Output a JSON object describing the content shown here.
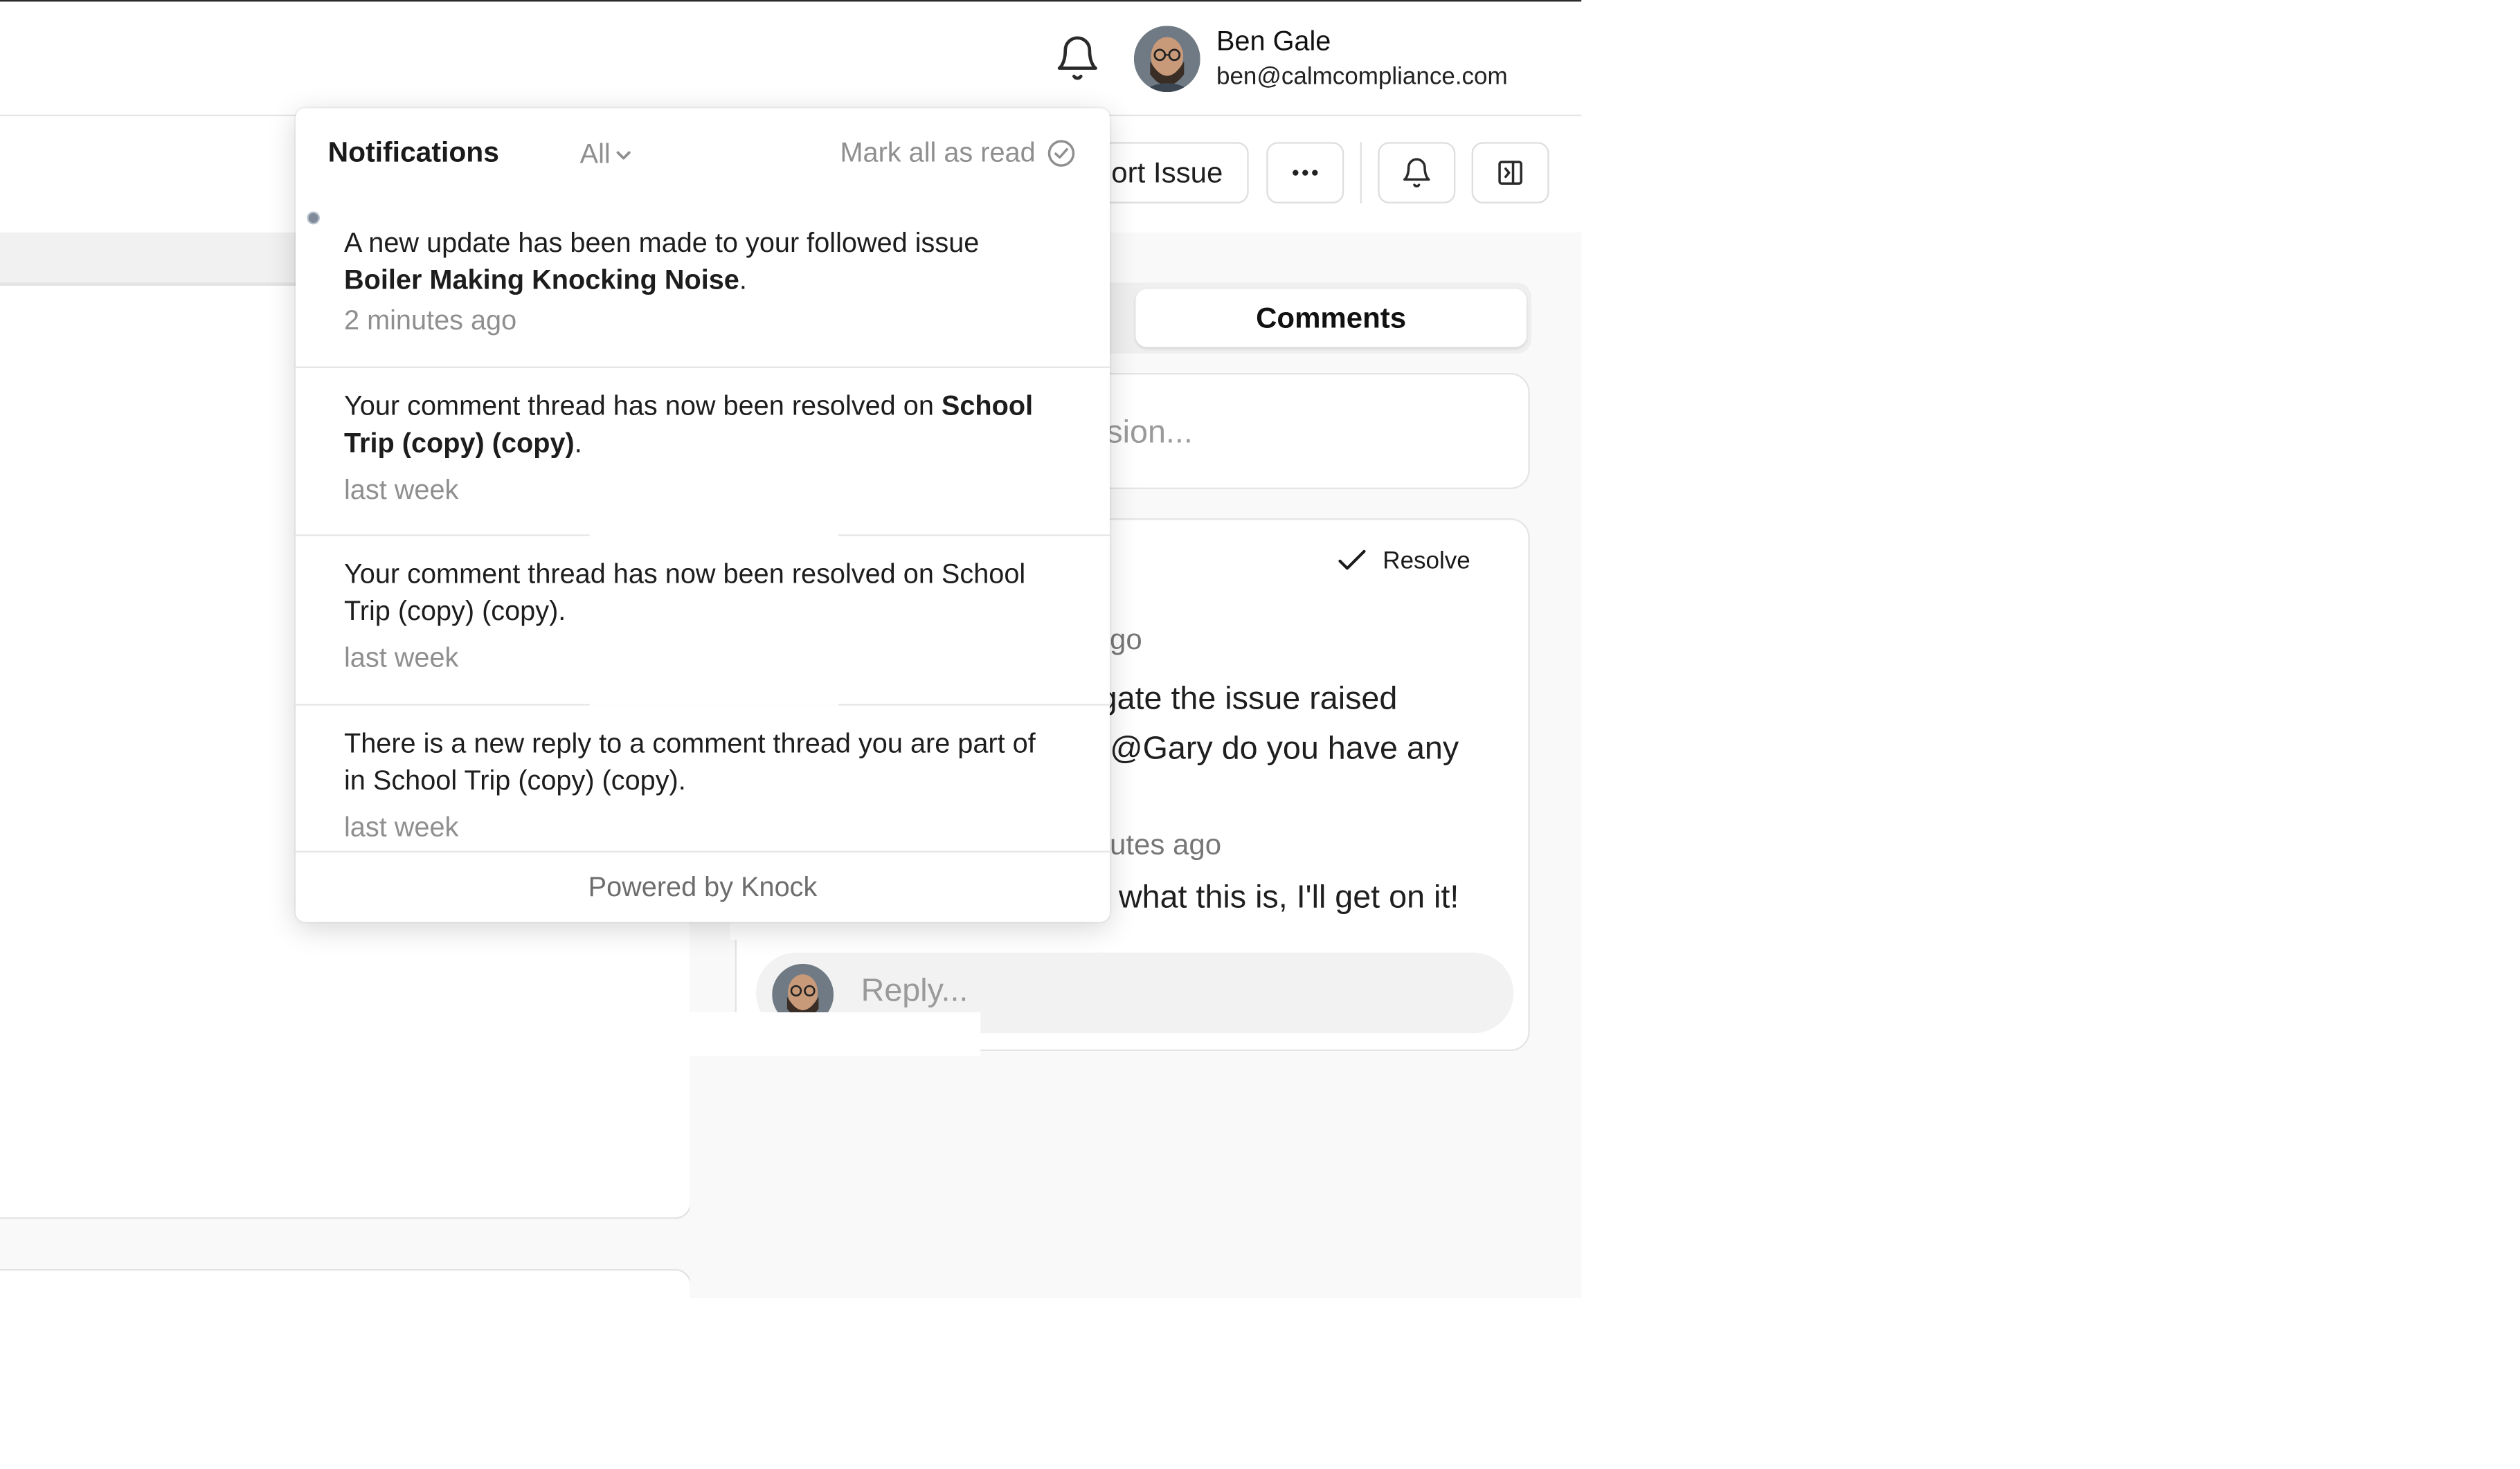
{
  "header": {
    "user": {
      "name": "Ben Gale",
      "email": "ben@calmcompliance.com"
    }
  },
  "toolbar": {
    "report_label": "ort Issue",
    "more_label": "⋯"
  },
  "comments": {
    "tab_label": "Comments",
    "discussion_placeholder": "ssion...",
    "resolve_label": "Resolve",
    "comment1_time": "ago",
    "comment1_text": "igate the issue raised\n. @Gary do you have any",
    "comment2_time": "nutes ago",
    "comment2_text": "v what this is, I'll get on it!",
    "reply_placeholder": "Reply..."
  },
  "notifications": {
    "title": "Notifications",
    "filter": "All",
    "mark_all_label": "Mark all as read",
    "footer": "Powered by Knock",
    "items": [
      {
        "text_before": "A new update has been made to your followed issue ",
        "bold": "Boiler Making Knocking Noise",
        "text_after": ".",
        "time": "2 minutes ago",
        "unread": true
      },
      {
        "text_before": "Your comment thread has now been resolved on ",
        "bold": "School Trip (copy) (copy)",
        "text_after": ".",
        "time": "last week",
        "unread": false
      },
      {
        "text_before": "Your comment thread has now been resolved on School Trip (copy) (copy).",
        "bold": "",
        "text_after": "",
        "time": "last week",
        "unread": false
      },
      {
        "text_before": "There is a new reply to a comment thread you are part of in School Trip (copy) (copy).",
        "bold": "",
        "text_after": "",
        "time": "last week",
        "unread": false
      }
    ]
  }
}
